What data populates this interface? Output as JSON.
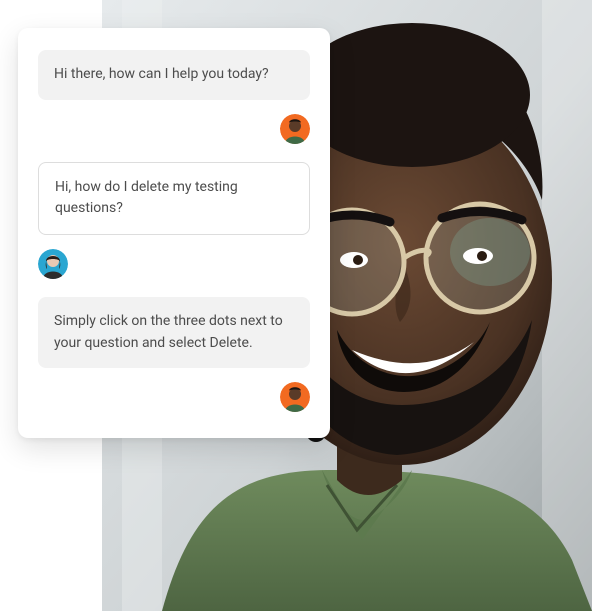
{
  "chat": {
    "messages": [
      {
        "role": "agent",
        "text": "Hi there, how can I help you today?"
      },
      {
        "role": "user",
        "text": "Hi, how do I delete my testing questions?"
      },
      {
        "role": "agent",
        "text": "Simply click on the three dots next to your question and select Delete."
      }
    ],
    "avatars": {
      "agent": {
        "name": "agent-avatar",
        "bg": "#f26a21"
      },
      "user": {
        "name": "user-avatar",
        "bg": "#2aa6d1"
      }
    }
  }
}
